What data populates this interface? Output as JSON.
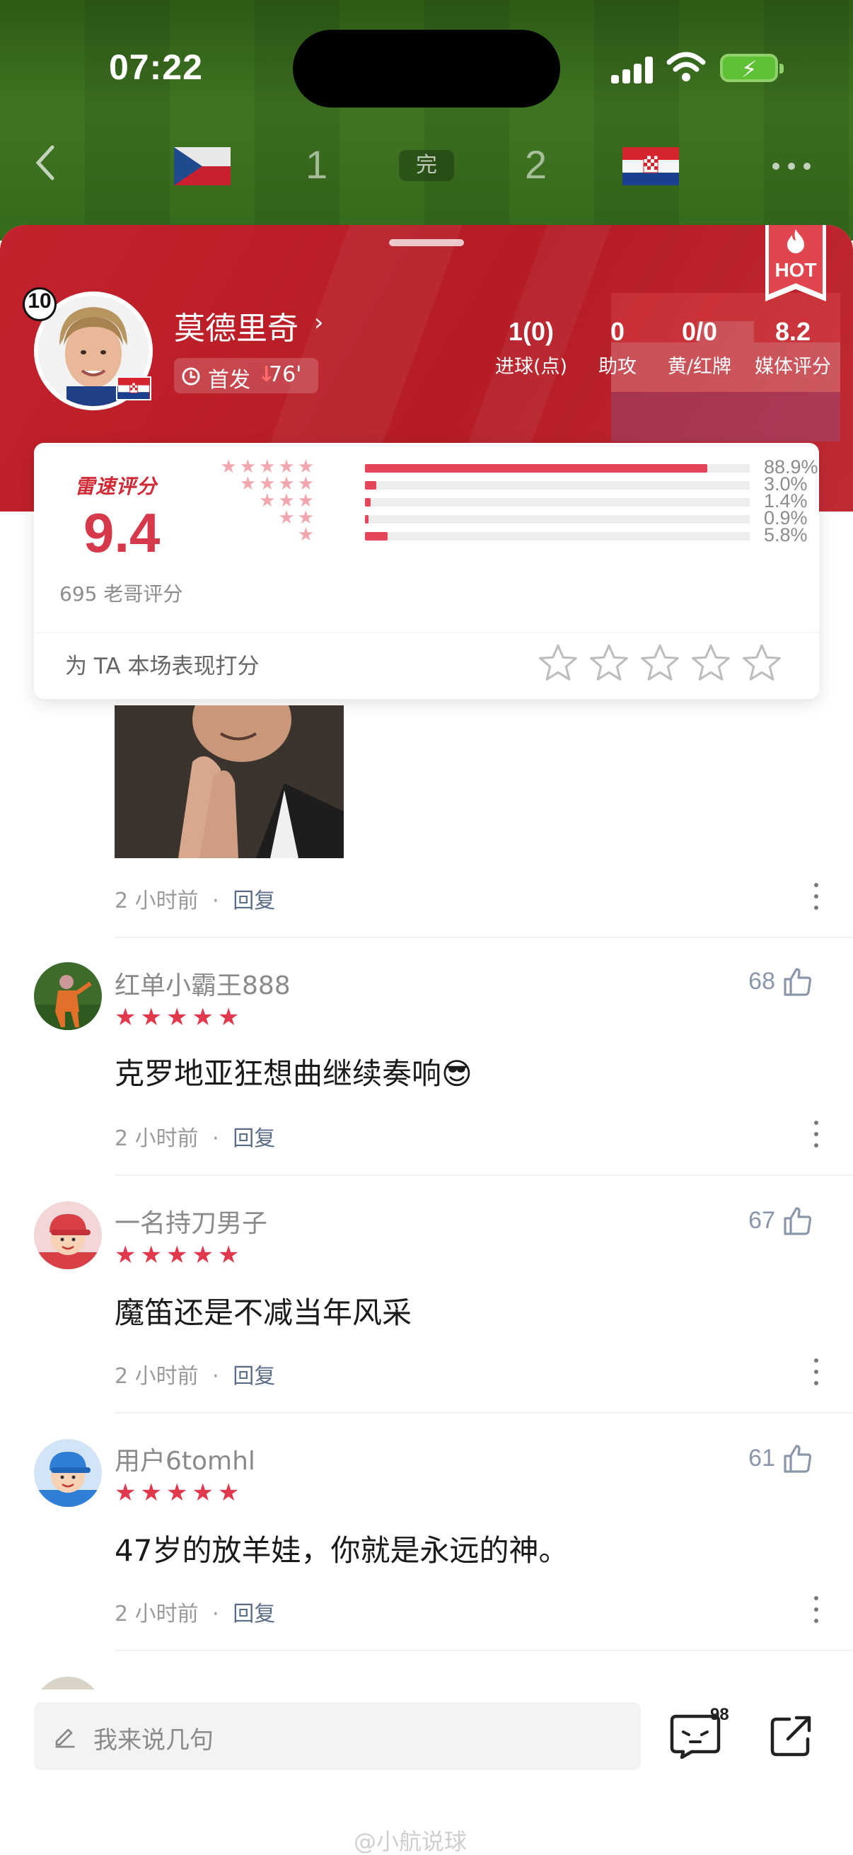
{
  "status_bar": {
    "time": "07:22"
  },
  "match": {
    "home_score": "1",
    "state": "完",
    "away_score": "2"
  },
  "player": {
    "number": "10",
    "name": "莫德里奇",
    "start_label": "首发",
    "sub_minute": "76'"
  },
  "badge": {
    "hot": "HOT"
  },
  "stats": [
    {
      "value": "1(0)",
      "label": "进球(点)"
    },
    {
      "value": "0",
      "label": "助攻"
    },
    {
      "value": "0/0",
      "label": "黄/红牌"
    },
    {
      "value": "8.2",
      "label": "媒体评分"
    }
  ],
  "rating": {
    "brand": "雷速评分",
    "score": "9.4",
    "count_label": "695 老哥评分",
    "prompt": "为 TA 本场表现打分",
    "distribution": [
      {
        "stars": "★★★★★",
        "pct": "88.9%",
        "fraction": 0.889
      },
      {
        "stars": "★★★★",
        "pct": "3.0%",
        "fraction": 0.03
      },
      {
        "stars": "★★★",
        "pct": "1.4%",
        "fraction": 0.014
      },
      {
        "stars": "★★",
        "pct": "0.9%",
        "fraction": 0.009
      },
      {
        "stars": "★",
        "pct": "5.8%",
        "fraction": 0.058
      }
    ]
  },
  "comments": [
    {
      "time": "2 小时前",
      "separator": "·",
      "reply": "回复"
    },
    {
      "user": "红单小霸王888",
      "stars": "★★★★★",
      "text": "克罗地亚狂想曲继续奏响😎",
      "likes": "68",
      "time": "2 小时前",
      "separator": "·",
      "reply": "回复"
    },
    {
      "user": "一名持刀男子",
      "stars": "★★★★★",
      "text": "魔笛还是不减当年风采",
      "likes": "67",
      "time": "2 小时前",
      "separator": "·",
      "reply": "回复"
    },
    {
      "user": "用户6tomhl",
      "stars": "★★★★★",
      "text": "47岁的放羊娃，你就是永远的神。",
      "likes": "61",
      "time": "2 小时前",
      "separator": "·",
      "reply": "回复"
    }
  ],
  "bottom_bar": {
    "placeholder": "我来说几句",
    "emoji_count": "98"
  },
  "watermark": "@小航说球",
  "colors": {
    "brand_red": "#c3222b",
    "rating_red": "#d6394a",
    "star_red": "#e2384d",
    "reply_blue": "#5b6c86"
  }
}
